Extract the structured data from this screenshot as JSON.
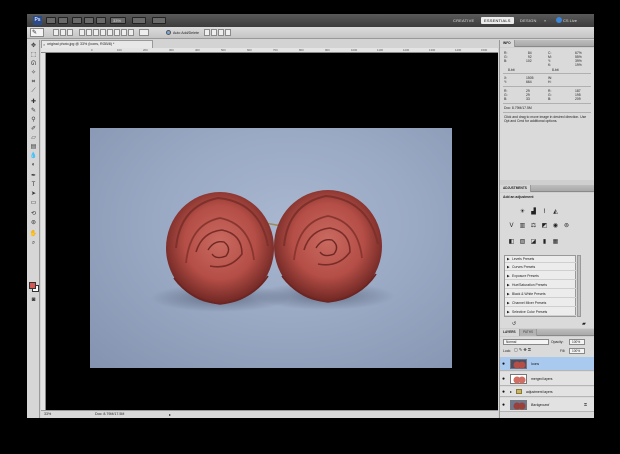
{
  "app": {
    "logo": "Ps",
    "zoom": "33%",
    "workspaces": [
      "CREATIVE",
      "ESSENTIALS",
      "DESIGN"
    ],
    "active_workspace": "ESSENTIALS",
    "more": "»",
    "cs_live": "CS Live"
  },
  "options": {
    "auto_add_label": "Auto Add/Delete"
  },
  "document": {
    "tab_label": "original photo.jpg @ 33% (Icons, RGB/8) *",
    "close_symbol": "×",
    "ruler_ticks": [
      "0",
      "100",
      "200",
      "300",
      "400",
      "500",
      "600",
      "700",
      "800",
      "900",
      "1000",
      "1100",
      "1200",
      "1300",
      "1400",
      "1500",
      "1600"
    ]
  },
  "status": {
    "zoom": "33%",
    "doc": "Doc: 8.79M/17.5M"
  },
  "info": {
    "tab": "INFO",
    "block1_left": [
      "R:",
      "G:",
      "B:"
    ],
    "block1_left_vals": [
      "84",
      "92",
      "102"
    ],
    "block1_right": [
      "C:",
      "M:",
      "Y:",
      "K:"
    ],
    "block1_right_vals": [
      "67%",
      "55%",
      "39%",
      "19%"
    ],
    "bit_left": "8-bit",
    "bit_right": "8-bit",
    "xy_labels": [
      "X:",
      "Y:"
    ],
    "xy_vals": [
      "1505",
      "664"
    ],
    "wh_labels": [
      "W:",
      "H:"
    ],
    "block2_left": [
      "R:",
      "G:",
      "B:"
    ],
    "block2_left_vals": [
      "29",
      "29",
      "33"
    ],
    "block2_right": [
      "R:",
      "G:",
      "B:"
    ],
    "block2_right_vals": [
      "187",
      "195",
      "209"
    ],
    "doc": "Doc: 8.79M/17.5M",
    "hint": "Click and drag to move image in desired direction. Use Opt and Cmd for additional options."
  },
  "adjustments": {
    "tab": "ADJUSTMENTS",
    "title": "Add an adjustment",
    "presets": [
      "Levels Presets",
      "Curves Presets",
      "Exposure Presets",
      "Hue/Saturation Presets",
      "Black & White Presets",
      "Channel Mixer Presets",
      "Selective Color Presets"
    ]
  },
  "layers": {
    "tabs": [
      "LAYERS",
      "PATHS"
    ],
    "blend_mode": "Normal",
    "opacity_label": "Opacity:",
    "opacity": "100%",
    "lock_label": "Lock:",
    "fill_label": "Fill:",
    "fill": "100%",
    "items": [
      {
        "name": "Icons",
        "selected": true
      },
      {
        "name": "merged layers",
        "selected": false
      },
      {
        "name": "adjustment layers",
        "selected": false
      },
      {
        "name": "Background",
        "selected": false
      }
    ]
  }
}
